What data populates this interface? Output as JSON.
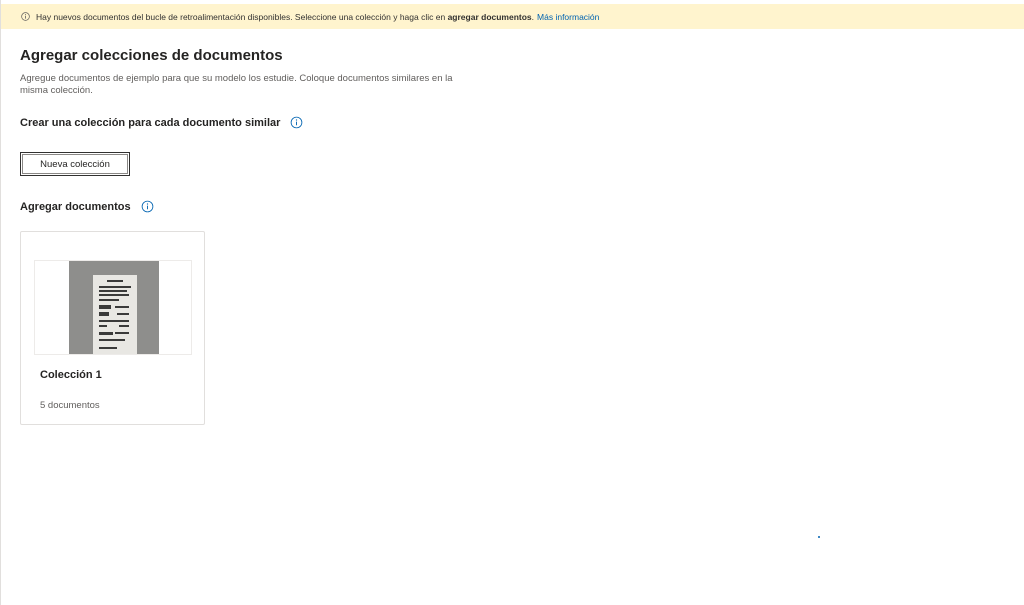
{
  "notice": {
    "text_before": "Hay nuevos documentos del bucle de retroalimentación disponibles. Seleccione una colección y haga clic en",
    "text_bold": "agregar documentos",
    "text_after": ".",
    "link": "Más información"
  },
  "page": {
    "title": "Agregar colecciones de documentos",
    "description": "Agregue documentos de ejemplo para que su modelo los estudie. Coloque documentos similares en la misma colección.",
    "create_heading": "Crear una colección para cada documento similar",
    "new_collection_button": "Nueva colección",
    "add_documents_heading": "Agregar documentos"
  },
  "collections": [
    {
      "name": "Colección 1",
      "count_label": "5 documentos"
    }
  ],
  "colors": {
    "notice_bg": "#fff4ce",
    "accent": "#0063b1"
  },
  "icons": {
    "notice": "info-icon",
    "heading_help": "info-circle-icon"
  }
}
